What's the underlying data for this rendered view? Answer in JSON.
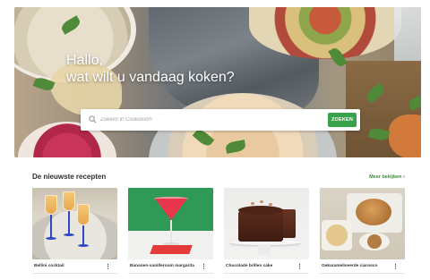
{
  "hero": {
    "title_line1": "Hallo,",
    "title_line2": "wat wilt u vandaag koken?",
    "search": {
      "placeholder": "Zoeken in Cookidoo®",
      "button_label": "ZOEKEN"
    }
  },
  "recipes": {
    "heading": "De nieuwste recepten",
    "view_all_label": "Meer bekijken",
    "view_all_arrow": "›",
    "items": [
      {
        "title": "Bellini cocktail",
        "menu": "⋮"
      },
      {
        "title": "Bananen-vanilleroom margarita",
        "menu": "⋮"
      },
      {
        "title": "Chocolade brillen cake",
        "menu": "⋮"
      },
      {
        "title": "Gekarameliseerde ciarosco",
        "menu": "⋮"
      }
    ]
  },
  "colors": {
    "accent_green": "#3aa24a",
    "link_green": "#3a8a3c"
  }
}
